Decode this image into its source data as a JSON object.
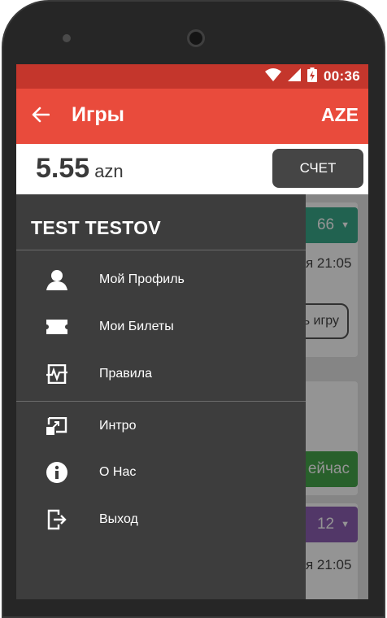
{
  "status_bar": {
    "time": "00:36",
    "icons": [
      "wifi-icon",
      "signal-icon",
      "battery-charging-icon"
    ]
  },
  "app_bar": {
    "back_icon": "arrow-back-icon",
    "title": "Игры",
    "region": "AZE"
  },
  "balance": {
    "amount": "5.55",
    "currency": "azn",
    "account_button": "СЧЕТ"
  },
  "drawer": {
    "user_name": "TEST TESTOV",
    "items": [
      {
        "label": "Мой Профиль",
        "icon": "profile-icon"
      },
      {
        "label": "Мои Билеты",
        "icon": "ticket-icon"
      },
      {
        "label": "Правила",
        "icon": "rules-icon"
      },
      {
        "label": "Интро",
        "icon": "intro-icon"
      },
      {
        "label": "О Нас",
        "icon": "info-icon"
      },
      {
        "label": "Выход",
        "icon": "exit-icon"
      }
    ]
  },
  "background": {
    "card1_badge": "66",
    "card1_time": "я 21:05",
    "card1_button": "ь игру",
    "card2_badge": "ейчас",
    "card3_badge": "12",
    "card3_time": "я 21:05"
  },
  "colors": {
    "status_bar": "#c4362c",
    "app_bar": "#e94b3c",
    "drawer": "#3d3d3d",
    "teal_badge": "#3aa98a",
    "green_badge": "#45a54a",
    "purple_badge": "#8e5fb4"
  }
}
